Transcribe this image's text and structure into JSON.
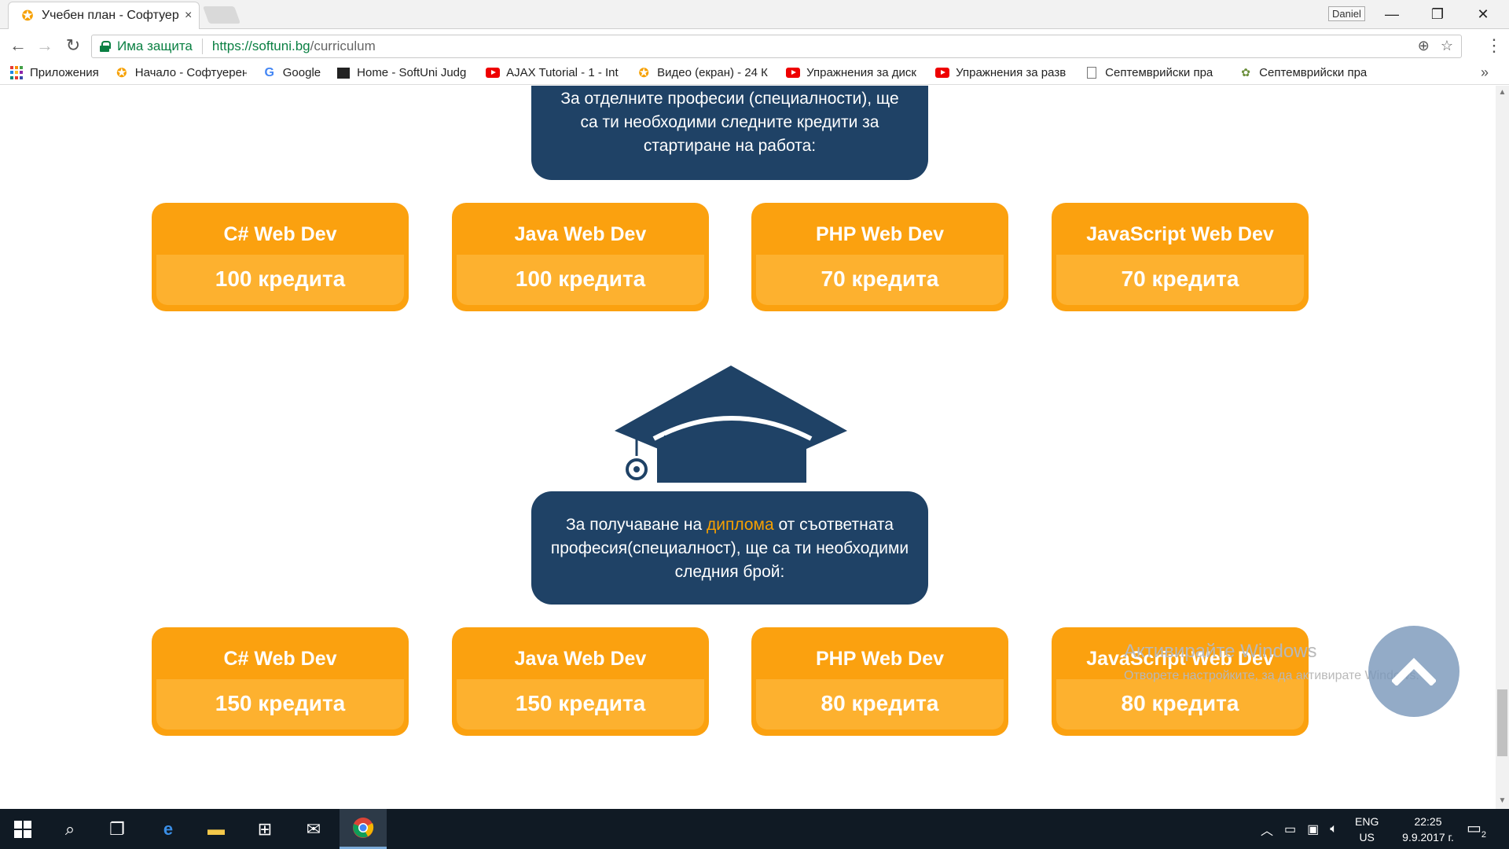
{
  "browser": {
    "tab_title": "Учебен план - Софтуер",
    "tab_close": "×",
    "profile_name": "Daniel",
    "window_controls": {
      "minimize": "—",
      "restore": "❐",
      "close": "✕"
    },
    "secure_label": "Има защита",
    "url_host": "https://softuni.bg",
    "url_path": "/curriculum",
    "menu": "⋮"
  },
  "bookmarks": [
    {
      "label": "Приложения",
      "icon": "apps-icon"
    },
    {
      "label": "Начало - Софтуерен",
      "icon": "softuni-icon"
    },
    {
      "label": "Google",
      "icon": "google-icon"
    },
    {
      "label": "Home - SoftUni Judg",
      "icon": "judge-icon"
    },
    {
      "label": "AJAX Tutorial - 1 - Int",
      "icon": "youtube-icon"
    },
    {
      "label": "Видео (екран) - 24 К",
      "icon": "softuni-icon"
    },
    {
      "label": "Упражнения за диск",
      "icon": "youtube-icon"
    },
    {
      "label": "Упражнения за разв",
      "icon": "youtube-icon"
    },
    {
      "label": "Септемврийски пра",
      "icon": "page-icon"
    },
    {
      "label": "Септемврийски пра",
      "icon": "turtle-icon"
    }
  ],
  "bookmarks_more": "»",
  "section_start": {
    "text": "За отделните професии (специалности), ще са ти необходими следните кредити за стартиране на работа:",
    "cards": [
      {
        "title": "C# Web Dev",
        "value": "100 кредита"
      },
      {
        "title": "Java Web Dev",
        "value": "100 кредита"
      },
      {
        "title": "PHP Web Dev",
        "value": "70 кредита"
      },
      {
        "title": "JavaScript Web Dev",
        "value": "70 кредита"
      }
    ]
  },
  "section_diploma": {
    "text_before": "За получаване на ",
    "text_highlight": "диплома",
    "text_after": " от съответната професия(специалност), ще са ти необходими следния брой:",
    "highlight_color": "#f6a000",
    "cards": [
      {
        "title": "C# Web Dev",
        "value": "150 кредита"
      },
      {
        "title": "Java Web Dev",
        "value": "150 кредита"
      },
      {
        "title": "PHP Web Dev",
        "value": "80 кредита"
      },
      {
        "title": "JavaScript Web Dev",
        "value": "80 кредита"
      }
    ]
  },
  "colors": {
    "navy": "#1f4266",
    "orange": "#fba10f",
    "orange_light": "#fdb12f"
  },
  "watermark": {
    "title": "Активирайте Windows",
    "subtitle": "Отворете настройките, за да активирате Windows."
  },
  "taskbar": {
    "lang_line1": "ENG",
    "lang_line2": "US",
    "time": "22:25",
    "date": "9.9.2017 г.",
    "notifications": "2"
  }
}
